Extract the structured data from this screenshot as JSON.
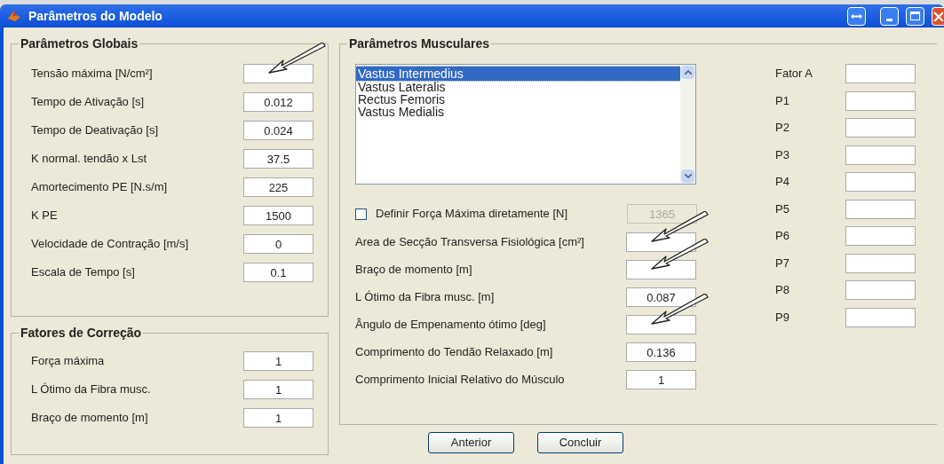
{
  "window": {
    "title": "Parâmetros do Modelo"
  },
  "global_params": {
    "title": "Parâmetros Globais",
    "rows": [
      {
        "label": "Tensão máxima [N/cm²]",
        "arrow": true
      },
      {
        "label": "Tempo de Ativação [s]",
        "value": "0.012",
        "arrow": false
      },
      {
        "label": "Tempo de Deativação [s]",
        "value": "0.024",
        "arrow": false
      },
      {
        "label": "K normal. tendão x Lst",
        "value": "37.5",
        "arrow": false
      },
      {
        "label": "Amortecimento PE [N.s/m]",
        "value": "225",
        "arrow": false
      },
      {
        "label": "K PE",
        "value": "1500",
        "arrow": false
      },
      {
        "label": "Velocidade de Contração [m/s]",
        "value": "0",
        "arrow": false
      },
      {
        "label": "Escala de Tempo [s]",
        "value": "0.1",
        "arrow": false
      }
    ]
  },
  "correction_factors": {
    "title": "Fatores de Correção",
    "rows": [
      {
        "label": "Força máxima",
        "value": "1"
      },
      {
        "label": "L Ótimo da Fibra musc.",
        "value": "1"
      },
      {
        "label": "Braço de momento [m]",
        "value": "1"
      }
    ]
  },
  "muscle_params": {
    "title": "Parâmetros Musculares",
    "muscles": [
      {
        "label": "Vastus Intermedius",
        "selected": true
      },
      {
        "label": "Vastus Lateralis",
        "selected": false
      },
      {
        "label": "Rectus Femoris",
        "selected": false
      },
      {
        "label": "Vastus Medialis",
        "selected": false
      }
    ],
    "max_force": {
      "label": "Definir Força Máxima diretamente [N]",
      "checked": false,
      "value": "1365",
      "disabled": true
    },
    "rows": [
      {
        "label": "Area de Secção Transversa Fisiológica [cm²]",
        "arrow": true
      },
      {
        "label": "Braço de momento [m]",
        "arrow": true
      },
      {
        "label": "L Ótimo da Fibra musc. [m]",
        "value": "0.087",
        "arrow": false
      },
      {
        "label": "Ângulo de Empenamento ótimo [deg]",
        "arrow": true
      },
      {
        "label": "Comprimento do Tendão Relaxado [m]",
        "value": "0.136",
        "arrow": false
      },
      {
        "label": "Comprimento Inicial Relativo do Músculo",
        "value": "1",
        "arrow": false
      }
    ],
    "factors": [
      {
        "label": "Fator A"
      },
      {
        "label": "P1"
      },
      {
        "label": "P2"
      },
      {
        "label": "P3"
      },
      {
        "label": "P4"
      },
      {
        "label": "P5"
      },
      {
        "label": "P6"
      },
      {
        "label": "P7"
      },
      {
        "label": "P8"
      },
      {
        "label": "P9"
      }
    ]
  },
  "buttons": [
    "Anterior",
    "Concluir"
  ]
}
